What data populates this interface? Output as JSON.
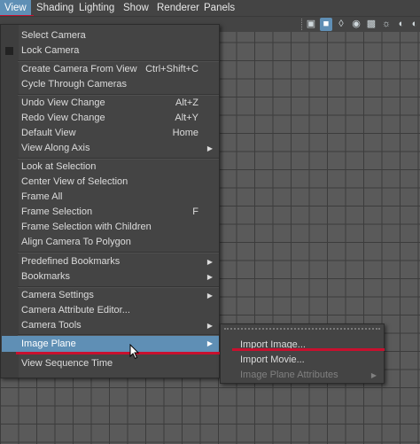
{
  "menubar": {
    "items": [
      "View",
      "Shading",
      "Lighting",
      "Show",
      "Renderer",
      "Panels"
    ]
  },
  "toolbar": {
    "icons": [
      "camera-select-icon",
      "filmgate-icon",
      "wireframe-icon",
      "smooth-shade-icon",
      "textured-icon",
      "lighting-icon",
      "shadows-icon",
      "isolate-icon",
      "xray-icon",
      "xray-joints-icon",
      "resolution-gate-icon",
      "grid-icon"
    ]
  },
  "view_menu": {
    "items": [
      {
        "label": "Select Camera"
      },
      {
        "label": "Lock Camera",
        "checkbox": true
      },
      {
        "label": "Create Camera From View",
        "shortcut": "Ctrl+Shift+C"
      },
      {
        "label": "Cycle Through Cameras"
      },
      {
        "label": "Undo View Change",
        "shortcut": "Alt+Z"
      },
      {
        "label": "Redo View Change",
        "shortcut": "Alt+Y"
      },
      {
        "label": "Default View",
        "shortcut": "Home"
      },
      {
        "label": "View Along Axis",
        "submenu": true
      },
      {
        "label": "Look at Selection"
      },
      {
        "label": "Center View of Selection"
      },
      {
        "label": "Frame All"
      },
      {
        "label": "Frame Selection",
        "shortcut": "F"
      },
      {
        "label": "Frame Selection with Children"
      },
      {
        "label": "Align Camera To Polygon"
      },
      {
        "label": "Predefined Bookmarks",
        "submenu": true
      },
      {
        "label": "Bookmarks",
        "submenu": true
      },
      {
        "label": "Camera Settings",
        "submenu": true
      },
      {
        "label": "Camera Attribute Editor..."
      },
      {
        "label": "Camera Tools",
        "submenu": true
      },
      {
        "label": "Image Plane",
        "submenu": true,
        "highlighted": true
      },
      {
        "label": "View Sequence Time"
      }
    ]
  },
  "image_plane_submenu": {
    "items": [
      {
        "label": "Import Image..."
      },
      {
        "label": "Import Movie..."
      },
      {
        "label": "Image Plane Attributes",
        "submenu": true,
        "disabled": true
      }
    ]
  },
  "colors": {
    "menu_bg": "#444444",
    "highlight": "#5f8fb5",
    "annotation_red": "#c8102e",
    "viewport_bg": "#5a5a5a",
    "grid_line": "#3c3c3c"
  }
}
